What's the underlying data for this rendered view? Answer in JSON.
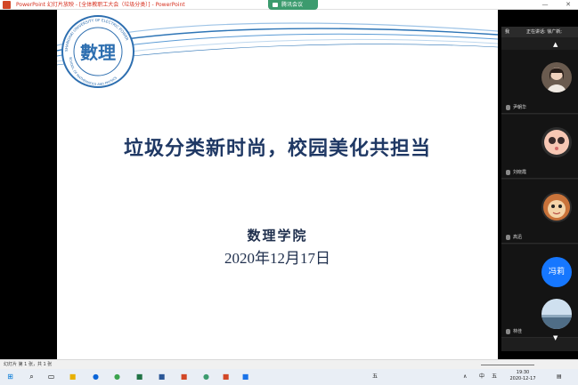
{
  "window": {
    "title": "PowerPoint 幻灯片放映 - [全体教职工大会（垃圾分类）] - PowerPoint",
    "meeting_tab": "腾讯会议",
    "minimize": "—",
    "close": "✕"
  },
  "slide": {
    "main_title": "垃圾分类新时尚，校园美化共担当",
    "college": "数理学院",
    "date": "2020年12月17日",
    "logo_chars": "數理",
    "logo_ring_top": "SHANGHAI UNIVERSITY OF ELECTRIC POWER",
    "logo_ring_bottom": "SCHOOL OF MATHEMATICS AND PHYSICS"
  },
  "sidebar": {
    "me": "我",
    "speaking_label": "正在讲话: 徐广新;",
    "up": "▲",
    "down": "▼",
    "participants": [
      {
        "name": "尹朝华",
        "avatar": "photo-woman"
      },
      {
        "name": "刘晓霞",
        "avatar": "cartoon-face"
      },
      {
        "name": "高迅",
        "avatar": "monkey-cartoon"
      },
      {
        "name": "冯莉",
        "avatar_text": "冯莉"
      },
      {
        "name": "林佳",
        "avatar": "landscape-photo"
      }
    ]
  },
  "status_bar": {
    "slide_info": "幻灯片 第 1 张，共 1 张",
    "ime": "五"
  },
  "taskbar": {
    "ime_lang": "中",
    "ime_mode": "五",
    "time": "19:30",
    "date": "2020-12-17"
  },
  "colors": {
    "title": "#1f3864",
    "wave": "#2e75b6",
    "ppt_accent": "#d24726",
    "meeting_green": "#3c9b6e"
  }
}
